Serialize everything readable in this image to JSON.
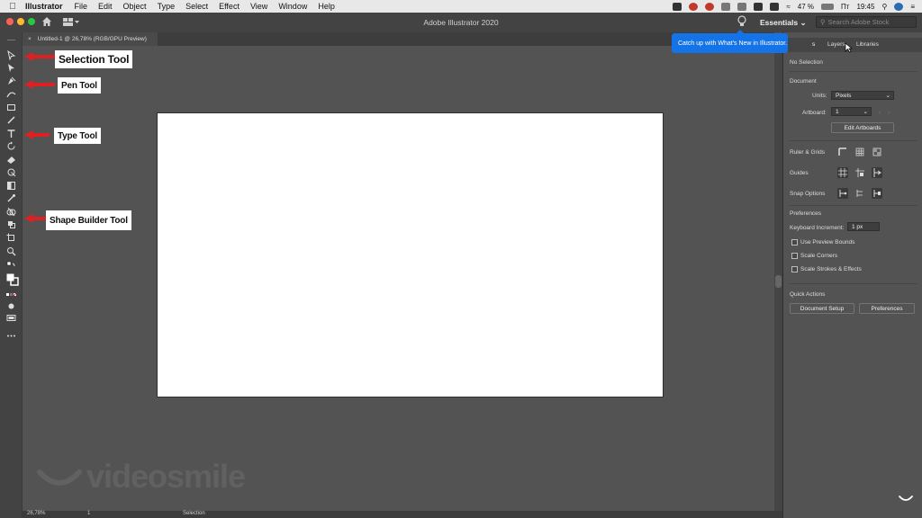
{
  "menubar": {
    "apple_icon": "apple-logo",
    "app_name": "Illustrator",
    "menus": [
      "File",
      "Edit",
      "Object",
      "Type",
      "Select",
      "Effect",
      "View",
      "Window",
      "Help"
    ],
    "battery": "47 %",
    "language": "Пт",
    "time": "19:45"
  },
  "titlebar": {
    "window_title": "Adobe Illustrator 2020",
    "workspace": "Essentials",
    "search_placeholder": "Search Adobe Stock"
  },
  "document": {
    "tab_close": "×",
    "tab_label": "Untitled-1 @ 26,78% (RGB/GPU Preview)"
  },
  "annotations": {
    "selection": "Selection Tool",
    "pen": "Pen Tool",
    "type": "Type Tool",
    "shape_builder": "Shape Builder Tool"
  },
  "watermark": "videosmile",
  "tooltip": "Catch up with What's New in Illustrator.",
  "panel": {
    "tabs": [
      "s",
      "Layers",
      "Libraries"
    ],
    "no_selection": "No Selection",
    "document_label": "Document",
    "units_label": "Units:",
    "units_value": "Pixels",
    "artboard_label": "Artboard:",
    "artboard_value": "1",
    "edit_artboards": "Edit Artboards",
    "ruler_grids": "Ruler & Grids",
    "guides": "Guides",
    "snap_options": "Snap Options",
    "preferences_label": "Preferences",
    "keyboard_increment_label": "Keyboard Increment:",
    "keyboard_increment_value": "1 px",
    "checkboxes": [
      "Use Preview Bounds",
      "Scale Corners",
      "Scale Strokes & Effects"
    ],
    "quick_actions": "Quick Actions",
    "document_setup": "Document Setup",
    "preferences_btn": "Preferences"
  },
  "statusbar": {
    "zoom": "26,78%",
    "artboard": "1",
    "tool": "Selection"
  },
  "colors": {
    "tooltip_blue": "#1473e6",
    "annotation_arrow": "#e02020",
    "ui_dark": "#434343",
    "canvas": "#535353"
  }
}
